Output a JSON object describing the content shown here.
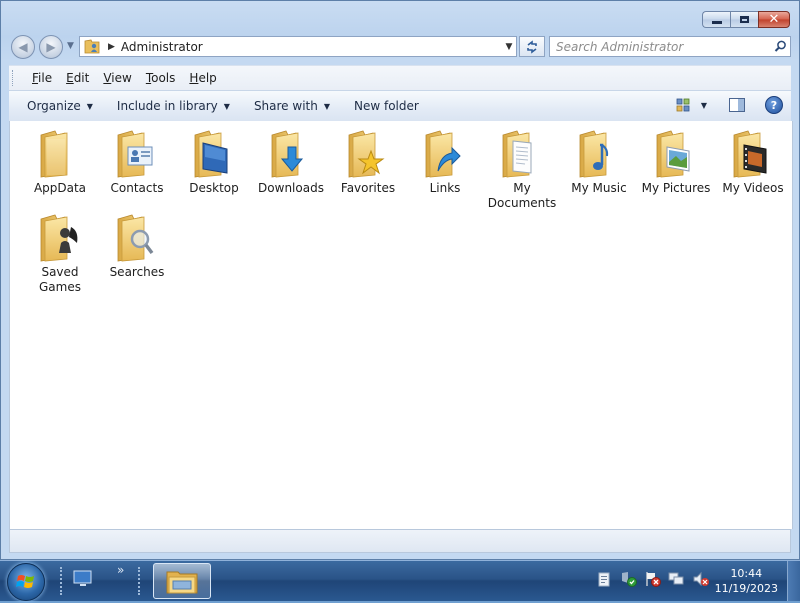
{
  "window": {
    "address": {
      "location": "Administrator"
    },
    "search": {
      "placeholder": "Search Administrator"
    },
    "menu": [
      {
        "label": "File",
        "mnemonic": "F",
        "rest": "ile"
      },
      {
        "label": "Edit",
        "mnemonic": "E",
        "rest": "dit"
      },
      {
        "label": "View",
        "mnemonic": "V",
        "rest": "iew"
      },
      {
        "label": "Tools",
        "mnemonic": "T",
        "rest": "ools"
      },
      {
        "label": "Help",
        "mnemonic": "H",
        "rest": "elp"
      }
    ],
    "commands": {
      "organize": "Organize",
      "include_in_library": "Include in library",
      "share_with": "Share with",
      "new_folder": "New folder"
    },
    "items": [
      {
        "name": "AppData",
        "icon": "folder-icon"
      },
      {
        "name": "Contacts",
        "icon": "contacts-folder-icon"
      },
      {
        "name": "Desktop",
        "icon": "desktop-folder-icon"
      },
      {
        "name": "Downloads",
        "icon": "downloads-folder-icon"
      },
      {
        "name": "Favorites",
        "icon": "favorites-folder-icon"
      },
      {
        "name": "Links",
        "icon": "links-folder-icon"
      },
      {
        "name": "My Documents",
        "icon": "documents-folder-icon"
      },
      {
        "name": "My Music",
        "icon": "music-folder-icon"
      },
      {
        "name": "My Pictures",
        "icon": "pictures-folder-icon"
      },
      {
        "name": "My Videos",
        "icon": "videos-folder-icon"
      },
      {
        "name": "Saved Games",
        "icon": "saved-games-folder-icon"
      },
      {
        "name": "Searches",
        "icon": "searches-folder-icon"
      }
    ]
  },
  "taskbar": {
    "clock": {
      "time": "10:44",
      "date": "11/19/2023"
    },
    "quicklaunch_more": "»"
  },
  "colors": {
    "folder": "#f3d27a",
    "folder_dark": "#d9ab45",
    "taskbar": "#2a5387",
    "frame": "#c4d9f1"
  }
}
